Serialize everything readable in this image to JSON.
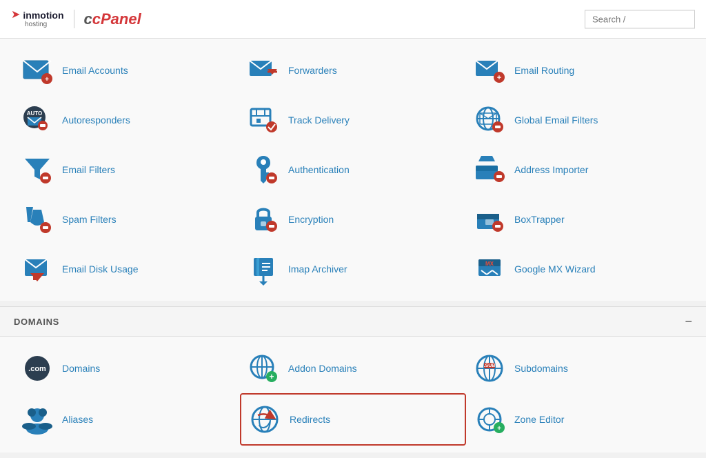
{
  "header": {
    "brand": "inmotion",
    "brand_sub": "hosting",
    "cpanel_label": "cPanel",
    "search_placeholder": "Search /"
  },
  "email_section": {
    "items": [
      {
        "id": "email-accounts",
        "label": "Email Accounts"
      },
      {
        "id": "forwarders",
        "label": "Forwarders"
      },
      {
        "id": "email-routing",
        "label": "Email Routing"
      },
      {
        "id": "autoresponders",
        "label": "Autoresponders"
      },
      {
        "id": "track-delivery",
        "label": "Track Delivery"
      },
      {
        "id": "global-email-filters",
        "label": "Global Email Filters"
      },
      {
        "id": "email-filters",
        "label": "Email Filters"
      },
      {
        "id": "authentication",
        "label": "Authentication"
      },
      {
        "id": "address-importer",
        "label": "Address Importer"
      },
      {
        "id": "spam-filters",
        "label": "Spam Filters"
      },
      {
        "id": "encryption",
        "label": "Encryption"
      },
      {
        "id": "boxtrapper",
        "label": "BoxTrapper"
      },
      {
        "id": "email-disk-usage",
        "label": "Email Disk Usage"
      },
      {
        "id": "imap-archiver",
        "label": "Imap Archiver"
      },
      {
        "id": "google-mx-wizard",
        "label": "Google MX Wizard"
      }
    ]
  },
  "domains_section": {
    "title": "DOMAINS",
    "collapse_icon": "−",
    "items": [
      {
        "id": "domains",
        "label": "Domains",
        "highlighted": false
      },
      {
        "id": "addon-domains",
        "label": "Addon Domains",
        "highlighted": false
      },
      {
        "id": "subdomains",
        "label": "Subdomains",
        "highlighted": false
      },
      {
        "id": "aliases",
        "label": "Aliases",
        "highlighted": false
      },
      {
        "id": "redirects",
        "label": "Redirects",
        "highlighted": true
      },
      {
        "id": "zone-editor",
        "label": "Zone Editor",
        "highlighted": false
      }
    ]
  }
}
